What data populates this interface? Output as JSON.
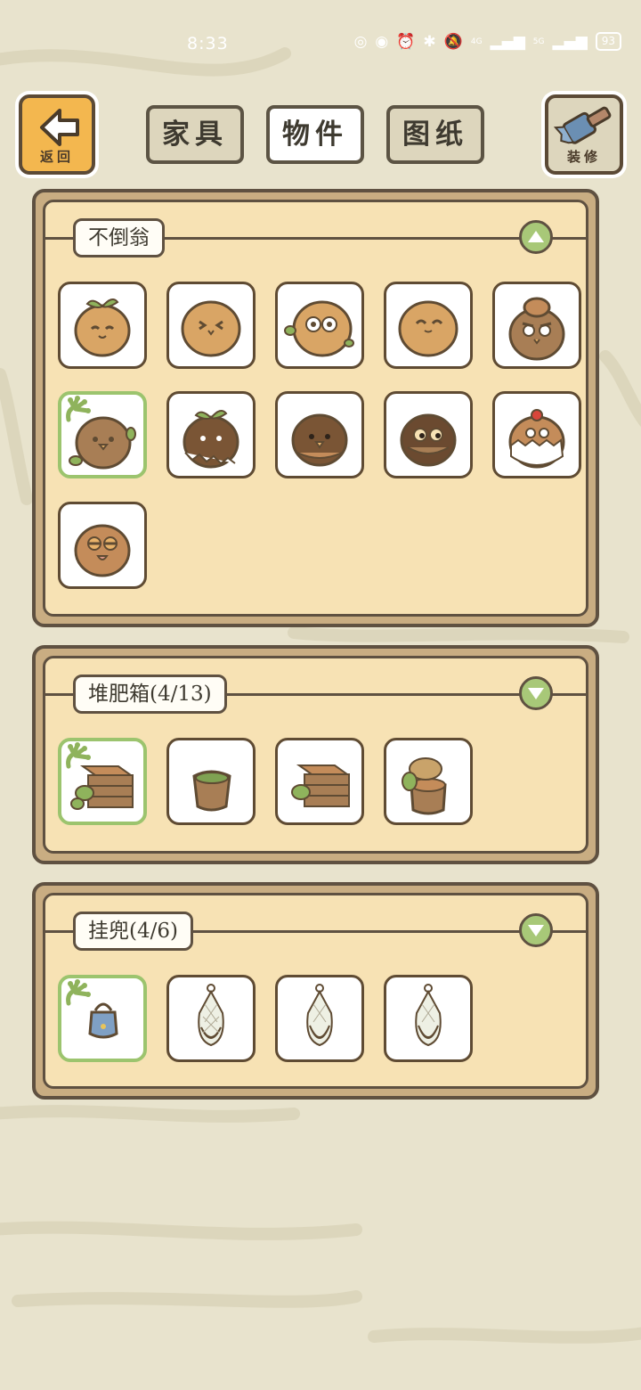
{
  "status_bar": {
    "time": "8:33",
    "signal_1": "4G",
    "signal_2": "5G",
    "battery": "93"
  },
  "header": {
    "back_label": "返回",
    "decorate_label": "装修",
    "tabs": [
      {
        "label": "家具",
        "active": false
      },
      {
        "label": "物件",
        "active": true
      },
      {
        "label": "图纸",
        "active": false
      }
    ]
  },
  "sections": [
    {
      "title": "不倒翁",
      "expanded": true,
      "items": [
        {
          "icon": "tumbler-sprout-icon",
          "selected": false
        },
        {
          "icon": "tumbler-squint-icon",
          "selected": false
        },
        {
          "icon": "tumbler-glasses-icon",
          "selected": false
        },
        {
          "icon": "tumbler-smile-icon",
          "selected": false
        },
        {
          "icon": "tumbler-cap-icon",
          "selected": false
        },
        {
          "icon": "tumbler-leaf-icon",
          "selected": true
        },
        {
          "icon": "tumbler-dark-sprout-icon",
          "selected": false
        },
        {
          "icon": "tumbler-dark-beak-icon",
          "selected": false
        },
        {
          "icon": "tumbler-dark-eyes-icon",
          "selected": false
        },
        {
          "icon": "tumbler-egg-icon",
          "selected": false
        },
        {
          "icon": "tumbler-sleepy-icon",
          "selected": false
        }
      ]
    },
    {
      "title": "堆肥箱(4/13)",
      "expanded": false,
      "items": [
        {
          "icon": "compost-crate-icon",
          "selected": true
        },
        {
          "icon": "compost-bucket-icon",
          "selected": false
        },
        {
          "icon": "compost-crate-icon",
          "selected": false
        },
        {
          "icon": "compost-stump-icon",
          "selected": false
        }
      ]
    },
    {
      "title": "挂兜(4/6)",
      "expanded": false,
      "items": [
        {
          "icon": "hanging-basket-icon",
          "selected": true
        },
        {
          "icon": "hanging-net-green-icon",
          "selected": false
        },
        {
          "icon": "hanging-net-blue-icon",
          "selected": false
        },
        {
          "icon": "hanging-net-orange-icon",
          "selected": false
        }
      ]
    }
  ],
  "colors": {
    "background": "#e8e3cd",
    "panel_fill": "#f7e2b4",
    "selected_border": "#9cc46e",
    "toggle": "#a8c878",
    "back_button": "#f3b74f"
  }
}
